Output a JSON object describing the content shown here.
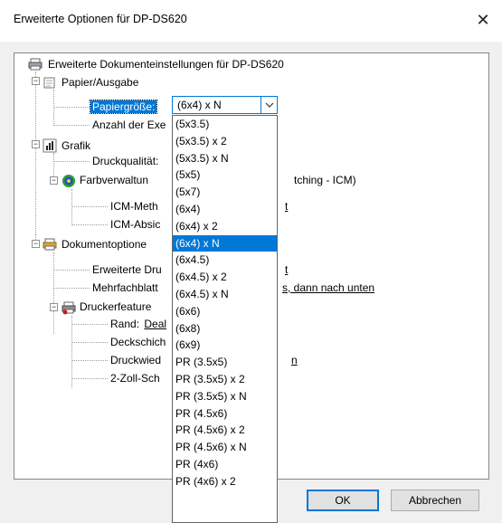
{
  "window": {
    "title": "Erweiterte Optionen für DP-DS620",
    "close_glyph": "✕"
  },
  "tree": {
    "root": "Erweiterte Dokumenteinstellungen für DP-DS620",
    "paper_group": "Papier/Ausgabe",
    "paper_size_label": "Papiergröße:",
    "copies_label": "Anzahl der Exe",
    "graphics_group": "Grafik",
    "print_quality_label": "Druckqualität:",
    "color_mgmt_label": "Farbverwaltun",
    "color_mgmt_tail": "tching - ICM)",
    "icm_method_label": "ICM-Meth",
    "icm_method_tail": "t",
    "icm_intent_label": "ICM-Absic",
    "doc_options_group": "Dokumentoptione",
    "advanced_print_label": "Erweiterte Dru",
    "advanced_print_tail": "t",
    "multipage_label": "Mehrfachblatt",
    "multipage_tail": "s, dann nach unten",
    "printer_features_group": "Druckerfeature",
    "edge_label": "Rand:",
    "edge_value": "Deal",
    "overcoat_label": "Deckschich",
    "reprint_label": "Druckwied",
    "reprint_tail": "n",
    "cut_label": "2-Zoll-Sch"
  },
  "combo": {
    "value": "(6x4) x N"
  },
  "dropdown": {
    "options": [
      "(5x3.5)",
      "(5x3.5) x 2",
      "(5x3.5) x N",
      "(5x5)",
      "(5x7)",
      "(6x4)",
      "(6x4) x 2",
      "(6x4) x N",
      "(6x4.5)",
      "(6x4.5) x 2",
      "(6x4.5) x N",
      "(6x6)",
      "(6x8)",
      "(6x9)",
      "PR (3.5x5)",
      "PR (3.5x5) x 2",
      "PR (3.5x5) x N",
      "PR (4.5x6)",
      "PR (4.5x6) x 2",
      "PR (4.5x6) x N",
      "PR (4x6)",
      "PR (4x6) x 2"
    ],
    "selected": "(6x4) x N"
  },
  "buttons": {
    "ok": "OK",
    "cancel": "Abbrechen"
  },
  "colors": {
    "accent": "#0078d7",
    "dialog_bg": "#f0f0f0"
  }
}
